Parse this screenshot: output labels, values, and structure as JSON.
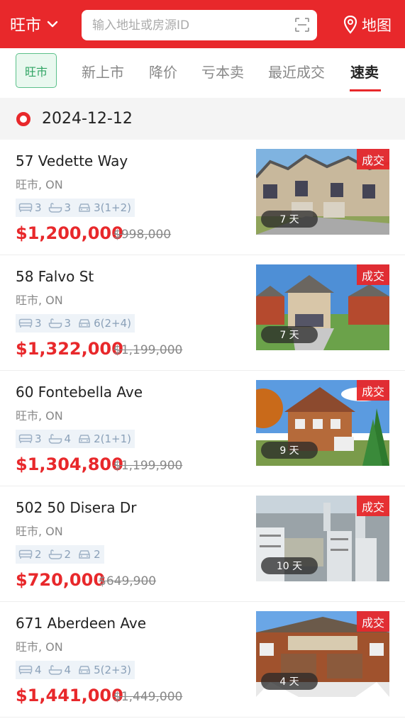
{
  "header": {
    "city": "旺市",
    "search_placeholder": "输入地址或房源ID",
    "map_label": "地图"
  },
  "tabs": {
    "region": "旺市",
    "items": [
      "新上市",
      "降价",
      "亏本卖",
      "最近成交",
      "速卖"
    ],
    "active": "速卖"
  },
  "date": "2024-12-12",
  "listings": [
    {
      "address": "57 Vedette Way",
      "city": "旺市, ON",
      "beds": "3",
      "baths": "3",
      "parking": "3(1+2)",
      "price": "$1,200,000",
      "old_price": "$998,000",
      "status": "成交",
      "days": "7 天"
    },
    {
      "address": "58 Falvo St",
      "city": "旺市, ON",
      "beds": "3",
      "baths": "3",
      "parking": "6(2+4)",
      "price": "$1,322,000",
      "old_price": "$1,199,000",
      "status": "成交",
      "days": "7 天"
    },
    {
      "address": "60 Fontebella Ave",
      "city": "旺市, ON",
      "beds": "3",
      "baths": "4",
      "parking": "2(1+1)",
      "price": "$1,304,800",
      "old_price": "$1,199,900",
      "status": "成交",
      "days": "9 天"
    },
    {
      "address": "502 50 Disera Dr",
      "city": "旺市, ON",
      "beds": "2",
      "baths": "2",
      "parking": "2",
      "price": "$720,000",
      "old_price": "$649,900",
      "status": "成交",
      "days": "10 天"
    },
    {
      "address": "671 Aberdeen Ave",
      "city": "旺市, ON",
      "beds": "4",
      "baths": "4",
      "parking": "5(2+3)",
      "price": "$1,441,000",
      "old_price": "$1,449,000",
      "status": "成交",
      "days": "4 天"
    }
  ],
  "colors": {
    "brand": "#e8282b",
    "region_tab": "#2fa463"
  }
}
